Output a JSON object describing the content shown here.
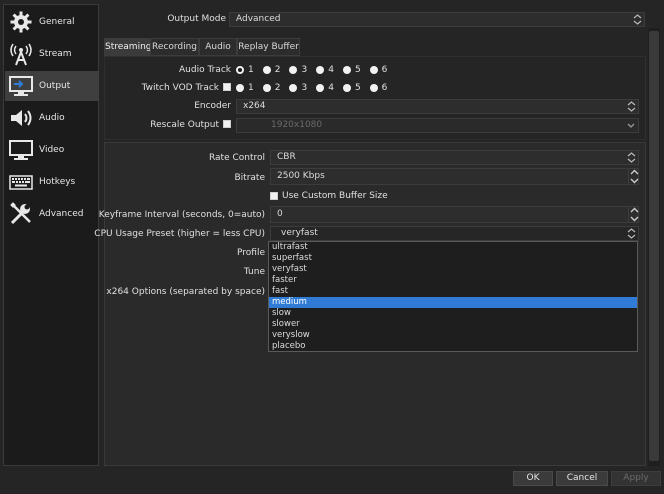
{
  "sidebar": {
    "items": [
      {
        "label": "General",
        "icon": "gear-icon"
      },
      {
        "label": "Stream",
        "icon": "antenna-icon"
      },
      {
        "label": "Output",
        "icon": "monitor-output-icon"
      },
      {
        "label": "Audio",
        "icon": "speaker-icon"
      },
      {
        "label": "Video",
        "icon": "monitor-icon"
      },
      {
        "label": "Hotkeys",
        "icon": "keyboard-icon"
      },
      {
        "label": "Advanced",
        "icon": "tools-icon"
      }
    ],
    "active_index": 2
  },
  "output_mode": {
    "label": "Output Mode",
    "value": "Advanced"
  },
  "tabs": [
    {
      "label": "Streaming"
    },
    {
      "label": "Recording"
    },
    {
      "label": "Audio"
    },
    {
      "label": "Replay Buffer"
    }
  ],
  "active_tab": 0,
  "audio_track": {
    "label": "Audio Track",
    "options": [
      "1",
      "2",
      "3",
      "4",
      "5",
      "6"
    ],
    "selected": "1"
  },
  "twitch_vod": {
    "label": "Twitch VOD Track",
    "options": [
      "1",
      "2",
      "3",
      "4",
      "5",
      "6"
    ],
    "checked": false
  },
  "encoder": {
    "label": "Encoder",
    "value": "x264"
  },
  "rescale": {
    "label": "Rescale Output",
    "value": "1920x1080",
    "checked": false
  },
  "rate_control": {
    "label": "Rate Control",
    "value": "CBR"
  },
  "bitrate": {
    "label": "Bitrate",
    "value": "2500 Kbps"
  },
  "custom_buffer": {
    "label": "Use Custom Buffer Size",
    "checked": false
  },
  "keyframe": {
    "label": "Keyframe Interval (seconds, 0=auto)",
    "value": "0"
  },
  "cpu_preset": {
    "label": "CPU Usage Preset (higher = less CPU)",
    "value": "veryfast",
    "options": [
      "ultrafast",
      "superfast",
      "veryfast",
      "faster",
      "fast",
      "medium",
      "slow",
      "slower",
      "veryslow",
      "placebo"
    ],
    "highlighted": "medium"
  },
  "profile": {
    "label": "Profile"
  },
  "tune": {
    "label": "Tune"
  },
  "x264_options": {
    "label": "x264 Options (separated by space)"
  },
  "buttons": {
    "ok": "OK",
    "cancel": "Cancel",
    "apply": "Apply"
  },
  "colors": {
    "highlight": "#2f7bd6",
    "background": "#252525",
    "sidebar": "#1b1b1b"
  }
}
